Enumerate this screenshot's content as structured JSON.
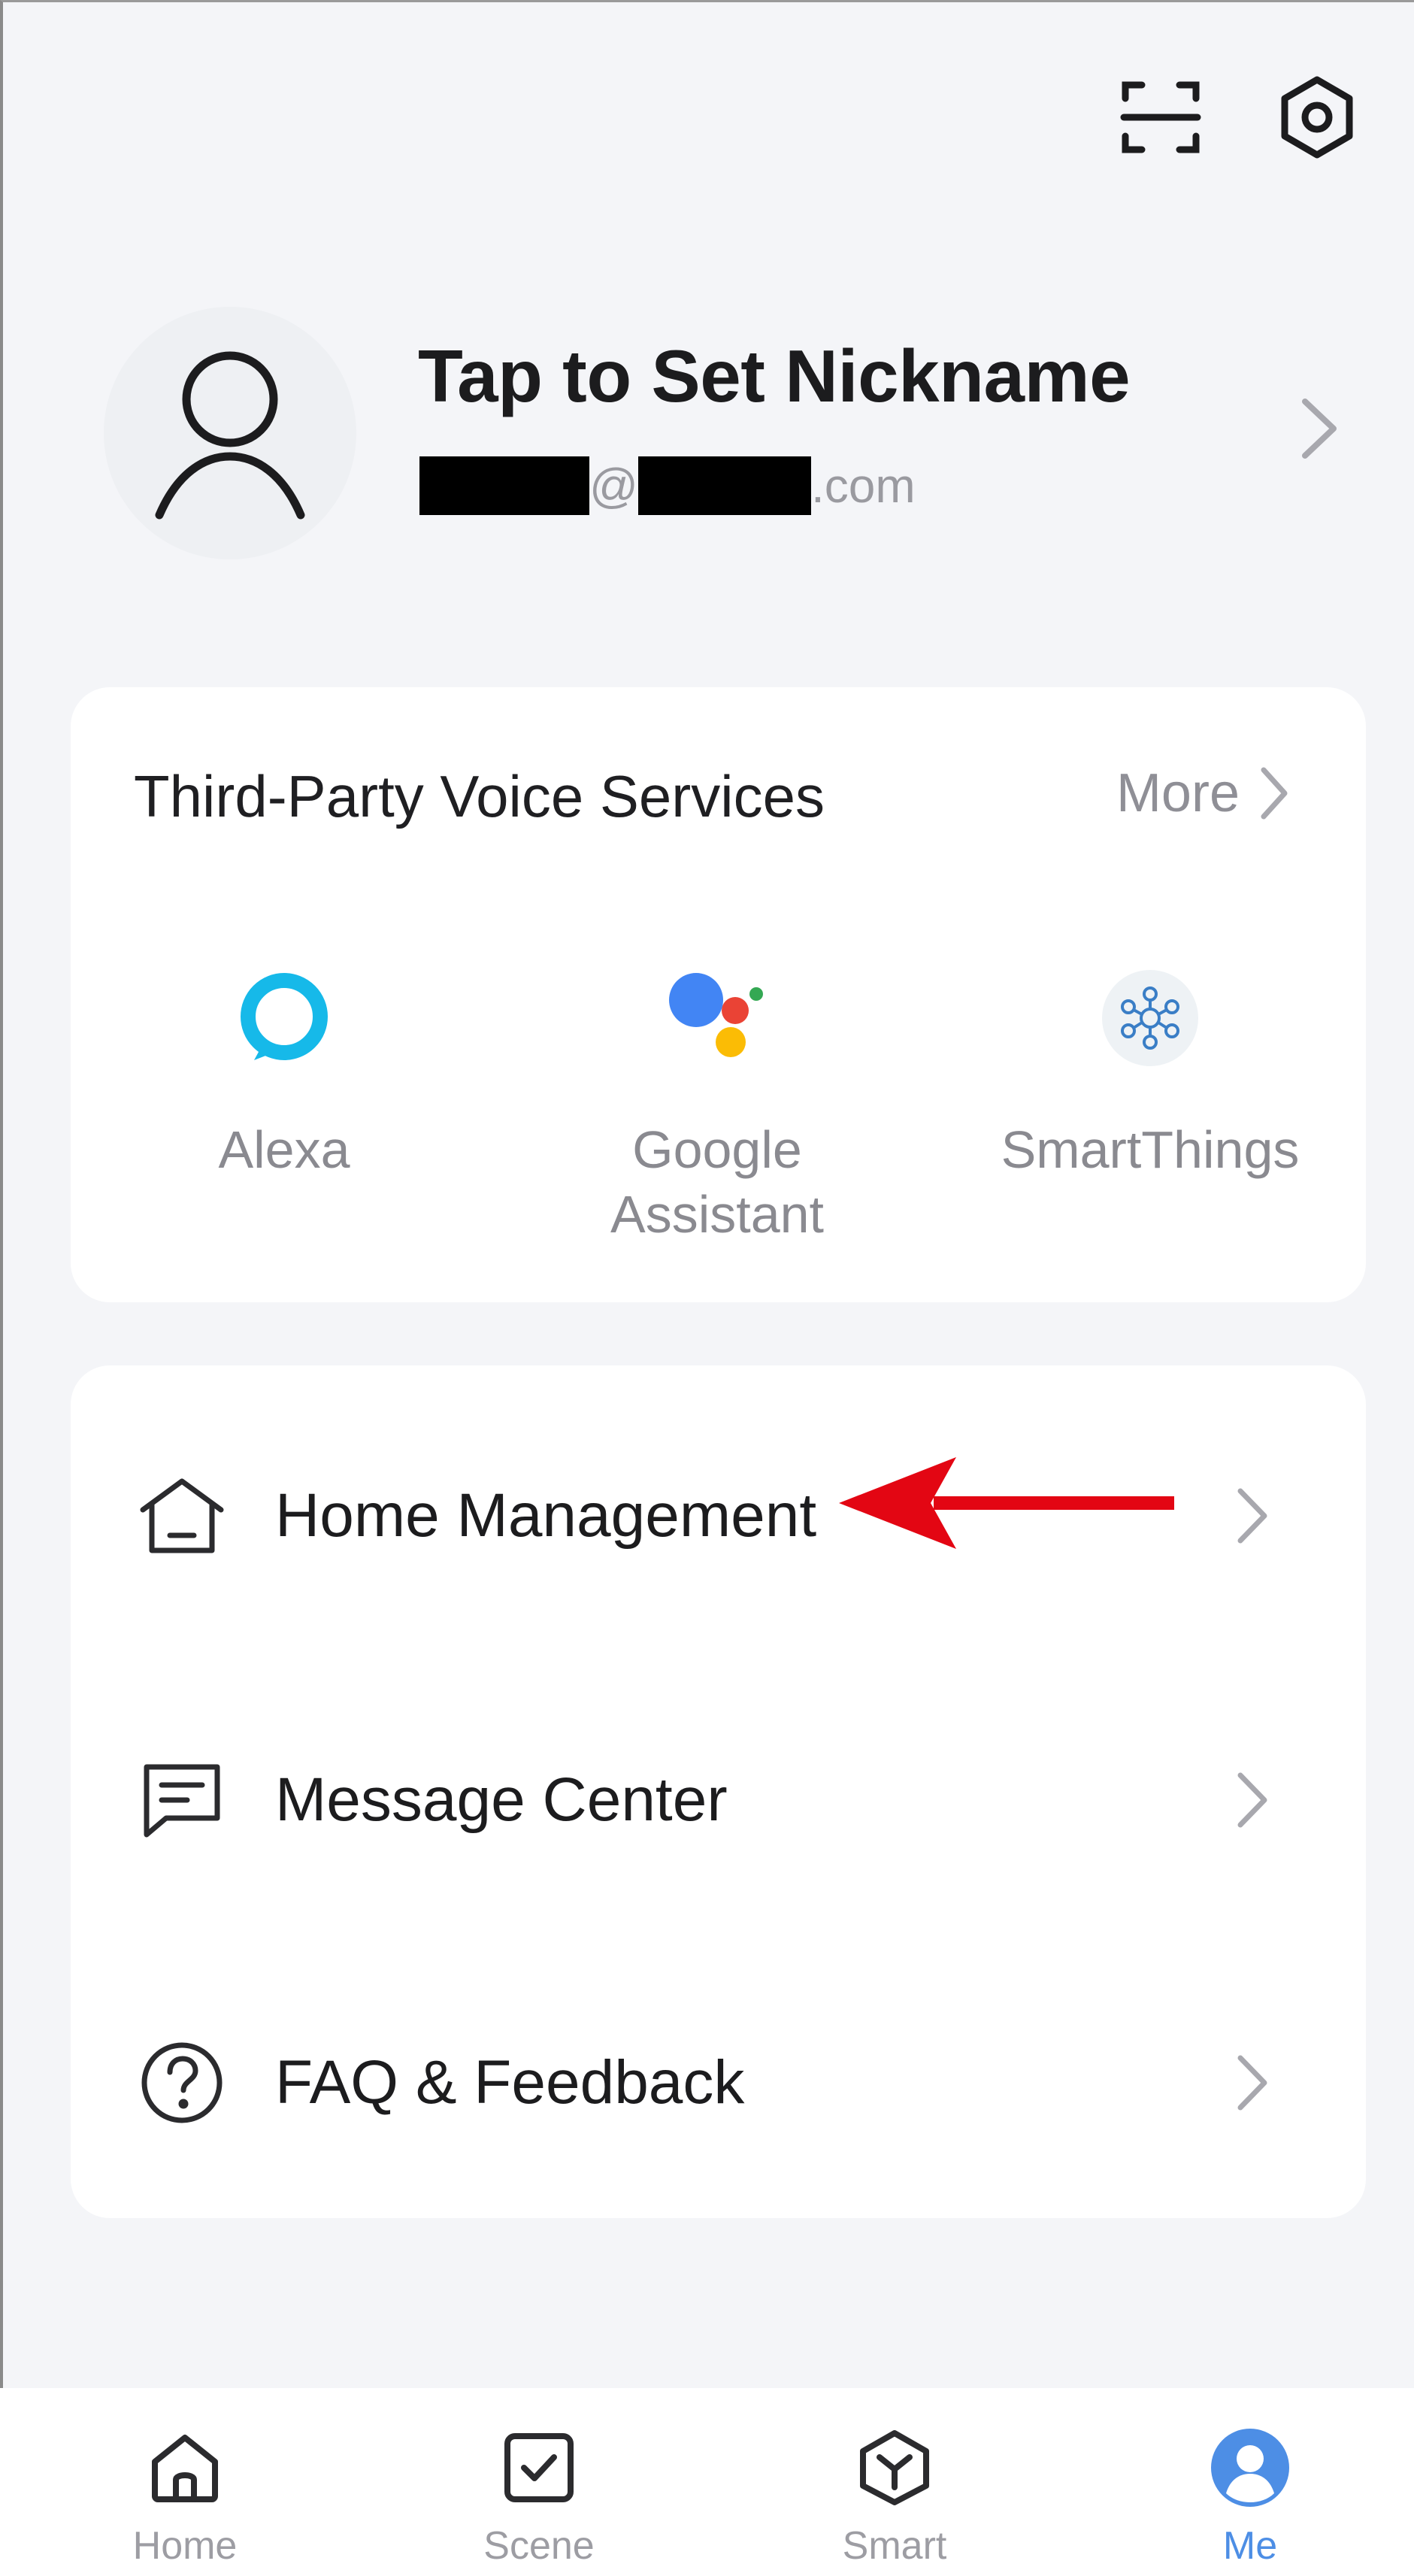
{
  "header": {
    "scan_icon": "scan-icon",
    "settings_icon": "settings-hex-icon"
  },
  "profile": {
    "nickname": "Tap to Set Nickname",
    "email_at": "@",
    "email_suffix": ".com",
    "avatar_icon": "user-outline-icon"
  },
  "voice_services": {
    "title": "Third-Party Voice Services",
    "more_label": "More",
    "items": [
      {
        "label": "Alexa",
        "icon": "alexa-icon"
      },
      {
        "label": "Google\nAssistant",
        "icon": "google-assistant-icon"
      },
      {
        "label": "SmartThings",
        "icon": "smartthings-icon"
      }
    ]
  },
  "menu": {
    "items": [
      {
        "label": "Home Management",
        "icon": "home-outline-icon"
      },
      {
        "label": "Message Center",
        "icon": "message-icon"
      },
      {
        "label": "FAQ & Feedback",
        "icon": "question-circle-icon"
      }
    ]
  },
  "tabs": [
    {
      "label": "Home",
      "icon": "home-tab-icon",
      "active": false
    },
    {
      "label": "Scene",
      "icon": "scene-check-icon",
      "active": false
    },
    {
      "label": "Smart",
      "icon": "smart-cube-icon",
      "active": false
    },
    {
      "label": "Me",
      "icon": "me-profile-icon",
      "active": true
    }
  ],
  "colors": {
    "background": "#f4f5f8",
    "card": "#ffffff",
    "accent": "#4d8ee5",
    "alexa": "#16b9e9",
    "annotation_arrow": "#e30613"
  }
}
